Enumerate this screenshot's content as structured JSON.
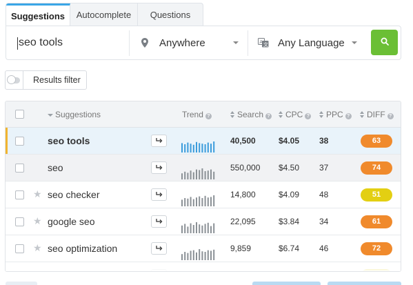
{
  "tabs": [
    {
      "label": "Suggestions",
      "active": true
    },
    {
      "label": "Autocomplete",
      "active": false
    },
    {
      "label": "Questions",
      "active": false
    }
  ],
  "search": {
    "keyword": "seo tools",
    "location": "Anywhere",
    "language": "Any Language",
    "icons": {
      "location": "map-pin-icon",
      "language": "language-icon",
      "submit": "search-icon"
    },
    "submit_color": "#6bbf35"
  },
  "filter": {
    "label": "Results filter",
    "toggle_on": false
  },
  "table": {
    "headers": {
      "keyword": "Suggestions",
      "trend": "Trend",
      "search": "Search",
      "cpc": "CPC",
      "ppc": "PPC",
      "diff": "DIFF"
    },
    "rows": [
      {
        "keyword": "seo tools",
        "search": "40,500",
        "cpc": "$4.05",
        "ppc": "38",
        "diff": "63",
        "diff_color": "#f08a2c",
        "state": "selected",
        "trend_color": "#3a9bdb",
        "trend": [
          0.85,
          0.75,
          0.9,
          0.8,
          0.7,
          0.95,
          0.85,
          0.8,
          0.75,
          0.9,
          0.8,
          1.0
        ]
      },
      {
        "keyword": "seo",
        "search": "550,000",
        "cpc": "$4.50",
        "ppc": "37",
        "diff": "74",
        "diff_color": "#f08a2c",
        "state": "hover",
        "trend_color": "#8a9095",
        "trend": [
          0.55,
          0.7,
          0.6,
          0.8,
          0.65,
          0.9,
          0.85,
          1.0,
          0.75,
          0.8,
          0.9,
          0.7
        ]
      },
      {
        "keyword": "seo checker",
        "search": "14,800",
        "cpc": "$4.09",
        "ppc": "48",
        "diff": "51",
        "diff_color": "#e3cf12",
        "state": "normal",
        "trend_color": "#8a9095",
        "trend": [
          0.6,
          0.75,
          0.7,
          0.85,
          0.65,
          0.8,
          0.9,
          0.75,
          0.95,
          0.8,
          0.85,
          1.0
        ]
      },
      {
        "keyword": "google seo",
        "search": "22,095",
        "cpc": "$3.84",
        "ppc": "34",
        "diff": "61",
        "diff_color": "#f08a2c",
        "state": "normal",
        "trend_color": "#8a9095",
        "trend": [
          0.7,
          0.85,
          0.6,
          0.9,
          0.75,
          1.0,
          0.8,
          0.7,
          0.85,
          0.95,
          0.65,
          0.9
        ]
      },
      {
        "keyword": "seo optimization",
        "search": "9,859",
        "cpc": "$6.74",
        "ppc": "46",
        "diff": "72",
        "diff_color": "#f08a2c",
        "state": "normal",
        "trend_color": "#8a9095",
        "trend": [
          0.55,
          0.75,
          0.65,
          0.85,
          0.9,
          0.7,
          1.0,
          0.8,
          0.75,
          0.9,
          0.85,
          0.95
        ]
      },
      {
        "keyword": "",
        "search": "",
        "cpc": "",
        "ppc": "",
        "diff": "",
        "diff_color": "#e3cf12",
        "state": "partial",
        "trend_color": "#8a9095",
        "trend": []
      }
    ]
  },
  "colors": {
    "accent": "#3aa6e6",
    "selected_marker": "#f1b42f"
  }
}
